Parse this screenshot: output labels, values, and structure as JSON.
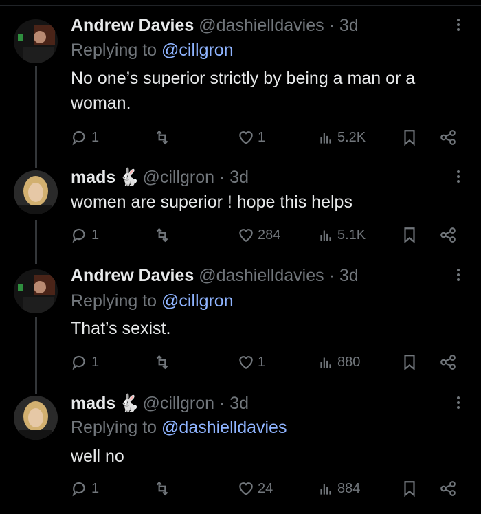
{
  "tweets": [
    {
      "name": "Andrew Davies",
      "handle": "@dashielldavies",
      "dot": "·",
      "time": "3d",
      "replying_prefix": "Replying to ",
      "replying_to": "@cillgron",
      "text": "No one’s superior strictly by being a man or a woman.",
      "replies": "1",
      "retweets": "",
      "likes": "1",
      "views": "5.2K"
    },
    {
      "name": "mads",
      "emoji": "🐇",
      "handle": "@cillgron",
      "dot": "·",
      "time": "3d",
      "text": "women are superior ! hope this helps",
      "replies": "1",
      "retweets": "",
      "likes": "284",
      "views": "5.1K"
    },
    {
      "name": "Andrew Davies",
      "handle": "@dashielldavies",
      "dot": "·",
      "time": "3d",
      "replying_prefix": "Replying to ",
      "replying_to": "@cillgron",
      "text": "That’s sexist.",
      "replies": "1",
      "retweets": "",
      "likes": "1",
      "views": "880"
    },
    {
      "name": "mads",
      "emoji": "🐇",
      "handle": "@cillgron",
      "dot": "·",
      "time": "3d",
      "replying_prefix": "Replying to ",
      "replying_to": "@dashielldavies",
      "text": "well no",
      "replies": "1",
      "retweets": "",
      "likes": "24",
      "views": "884"
    }
  ],
  "icons": {
    "reply": "reply-icon",
    "retweet": "retweet-icon",
    "like": "heart-icon",
    "views": "views-chart-icon",
    "bookmark": "bookmark-icon",
    "share": "share-icon",
    "more": "more-vertical-icon"
  },
  "colors": {
    "background": "#000000",
    "text": "#e7e9ea",
    "muted": "#71767b",
    "mention": "#8fb4ff",
    "thread_line": "#333639"
  }
}
